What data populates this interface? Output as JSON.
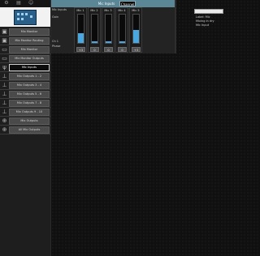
{
  "sidebar": {
    "items": [
      {
        "icon": "monitor-icon",
        "glyph": "▣",
        "label": "Mix Monitor"
      },
      {
        "icon": "monitor-icon",
        "glyph": "▣",
        "label": "Mix Monitor Routing"
      },
      {
        "icon": "output-icon",
        "glyph": "▭",
        "label": "Mix Monitor"
      },
      {
        "icon": "output-icon",
        "glyph": "▭",
        "label": "Mix Monitor Outputs"
      },
      {
        "icon": "input-icon",
        "glyph": "ψ",
        "label": "Mic Inputs"
      },
      {
        "icon": "tree-icon",
        "glyph": "⊥",
        "label": "Mix Outputs 1 - 2"
      },
      {
        "icon": "tree-icon",
        "glyph": "⊥",
        "label": "Mix Outputs 3 - 4"
      },
      {
        "icon": "tree-icon",
        "glyph": "⊥",
        "label": "Mix Outputs 5 - 6"
      },
      {
        "icon": "tree-icon",
        "glyph": "⊥",
        "label": "Mix Outputs 7 - 8"
      },
      {
        "icon": "tree-icon",
        "glyph": "⊥",
        "label": "Mix Outputs 9 - 10"
      },
      {
        "icon": "globe-icon",
        "glyph": "⊕",
        "label": "Mix Outputs"
      },
      {
        "icon": "globe-icon",
        "glyph": "⊕",
        "label": "All Mix Outputs"
      }
    ]
  },
  "panel": {
    "title": "Mic Inputs",
    "tab": "Channel",
    "left_labels": {
      "top": "Mic Inputs",
      "mid": "Gain",
      "ch": "Ch 1",
      "low": "Phase"
    },
    "channels": [
      {
        "name": "Mic 1",
        "level": 0.35,
        "value": "+3",
        "footer": "Mic 1"
      },
      {
        "name": "Mic 2",
        "level": 0.05,
        "value": "0",
        "footer": ""
      },
      {
        "name": "Mic 3",
        "level": 0.05,
        "value": "0",
        "footer": ""
      },
      {
        "name": "Mic 4",
        "level": 0.05,
        "value": "0",
        "footer": ""
      },
      {
        "name": "Mic 5",
        "level": 0.45,
        "value": "+3",
        "footer": "Mic 5"
      }
    ]
  },
  "info": {
    "input_value": "",
    "line1": "Label: Mic",
    "line2": "Mixing in dry",
    "line3": "  Mic Input"
  },
  "colors": {
    "accent": "#5a8696",
    "meter": "#4aa8e0"
  }
}
